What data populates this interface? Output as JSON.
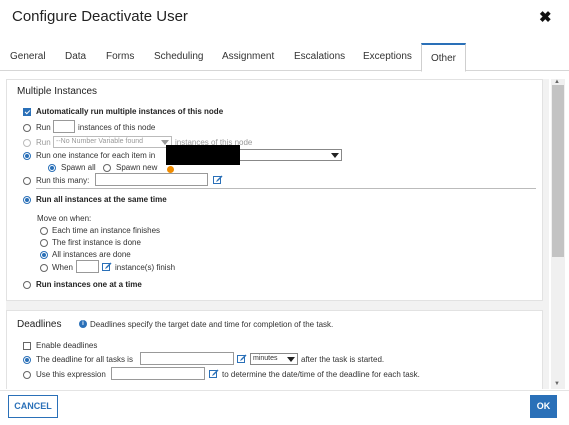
{
  "dialog": {
    "title": "Configure Deactivate User",
    "close_glyph": "✖"
  },
  "tabs": [
    {
      "label": "General"
    },
    {
      "label": "Data"
    },
    {
      "label": "Forms"
    },
    {
      "label": "Scheduling"
    },
    {
      "label": "Assignment"
    },
    {
      "label": "Escalations"
    },
    {
      "label": "Exceptions"
    },
    {
      "label": "Other",
      "active": true
    }
  ],
  "multiple_instances": {
    "heading": "Multiple Instances",
    "auto_run_label": "Automatically run multiple instances of this node",
    "run_label": "Run",
    "instances_of_node": "instances of this node",
    "no_variable_option": "--No Number Variable found",
    "run_each_label": "Run one instance for each item in",
    "spawn_all": "Spawn all",
    "spawn_new": "Spawn new",
    "run_this_many": "Run this many:",
    "run_all_same_time": "Run all instances at the same time",
    "move_on_when": "Move on when:",
    "opt_each_finishes": "Each time an instance finishes",
    "opt_first_done": "The first instance is done",
    "opt_all_done": "All instances are done",
    "opt_when": "When",
    "opt_when_suffix": "instance(s) finish",
    "run_one_at_a_time": "Run instances one at a time"
  },
  "deadlines": {
    "heading": "Deadlines",
    "info_text": "Deadlines specify the target date and time for completion of the task.",
    "enable_label": "Enable deadlines",
    "deadline_all_tasks": "The deadline for all tasks is",
    "unit_selected": "minutes",
    "after_started": "after the task is started.",
    "use_expression": "Use this expression",
    "expression_suffix": "to determine the date/time of the deadline for each task."
  },
  "footer": {
    "cancel_label": "CANCEL",
    "ok_label": "OK"
  },
  "colors": {
    "accent": "#2a70b8",
    "warning": "#f08c00"
  }
}
